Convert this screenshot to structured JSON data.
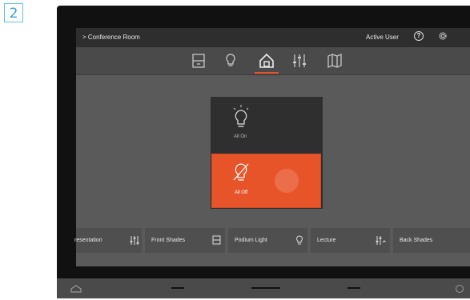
{
  "step_badge": "2",
  "header": {
    "room": "> Conference Room",
    "user": "Active User",
    "help_icon": "question-circle-icon",
    "settings_icon": "gear-icon"
  },
  "nav": {
    "tabs": [
      {
        "icon": "shade-icon"
      },
      {
        "icon": "lightbulb-icon"
      },
      {
        "icon": "home-icon",
        "active": true
      },
      {
        "icon": "sliders-icon"
      },
      {
        "icon": "map-icon"
      }
    ]
  },
  "lighting_menu": {
    "on_label": "All On",
    "off_label": "All Off"
  },
  "scenes": [
    {
      "label": "resentation",
      "icon": "sliders-icon"
    },
    {
      "label": "Front Shades",
      "icon": "shade-icon"
    },
    {
      "label": "Podium Light",
      "icon": "lightbulb-icon"
    },
    {
      "label": "Lecture",
      "icon": "sliders-icon"
    },
    {
      "label": "Back Shades",
      "icon": ""
    }
  ],
  "colors": {
    "accent": "#e8542a",
    "device": "#111111",
    "screen": "#5a5a5a",
    "badge": "#2fa3cf"
  }
}
